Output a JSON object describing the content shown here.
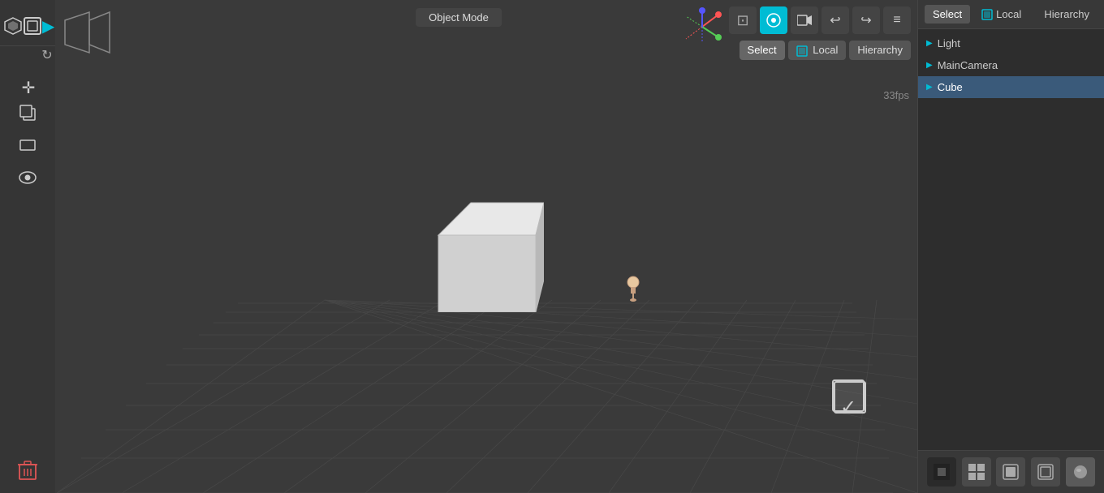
{
  "mode_bar": {
    "label": "Object Mode"
  },
  "fps": {
    "label": "33fps"
  },
  "toolbar": {
    "top_buttons": [
      {
        "name": "logo-btn",
        "icon": "⬡",
        "label": "Logo"
      },
      {
        "name": "cube-icon-btn",
        "icon": "▣",
        "label": "Cube"
      },
      {
        "name": "play-btn",
        "icon": "▶",
        "label": "Play"
      }
    ],
    "side_buttons": [
      {
        "name": "move-tool-btn",
        "icon": "✛",
        "label": "Move"
      },
      {
        "name": "copy-btn",
        "icon": "❏",
        "label": "Copy"
      },
      {
        "name": "rect-btn",
        "icon": "▭",
        "label": "Rectangle"
      },
      {
        "name": "eye-btn",
        "icon": "👁",
        "label": "Visibility"
      }
    ],
    "delete_btn": {
      "name": "delete-btn",
      "icon": "🗑",
      "label": "Delete"
    }
  },
  "top_right_tools": [
    {
      "name": "nav-gizmo",
      "icon": "⊕"
    },
    {
      "name": "ortho-view-btn",
      "icon": "⊡"
    },
    {
      "name": "camera-view-btn",
      "icon": "👁",
      "active": true
    },
    {
      "name": "video-btn",
      "icon": "▥"
    },
    {
      "name": "undo-btn",
      "icon": "↩"
    },
    {
      "name": "redo-btn",
      "icon": "↪"
    },
    {
      "name": "menu-btn",
      "icon": "≡"
    }
  ],
  "select_bar": {
    "select_label": "Select",
    "local_label": "Local",
    "hierarchy_label": "Hierarchy"
  },
  "hierarchy_items": [
    {
      "name": "Light",
      "icon": "▶",
      "selected": false
    },
    {
      "name": "MainCamera",
      "icon": "▶",
      "selected": false
    },
    {
      "name": "Cube",
      "icon": "▶",
      "selected": true
    }
  ],
  "panel_bottom_toolbar": [
    {
      "name": "shading-btn-dark",
      "icon": "◼"
    },
    {
      "name": "shading-btn-grid",
      "icon": "⊞"
    },
    {
      "name": "shading-btn-solid",
      "icon": "⬛"
    },
    {
      "name": "shading-btn-outline",
      "icon": "◻"
    },
    {
      "name": "shading-btn-sphere",
      "icon": "○"
    }
  ],
  "selection_box": {
    "checkmark": "✓"
  }
}
